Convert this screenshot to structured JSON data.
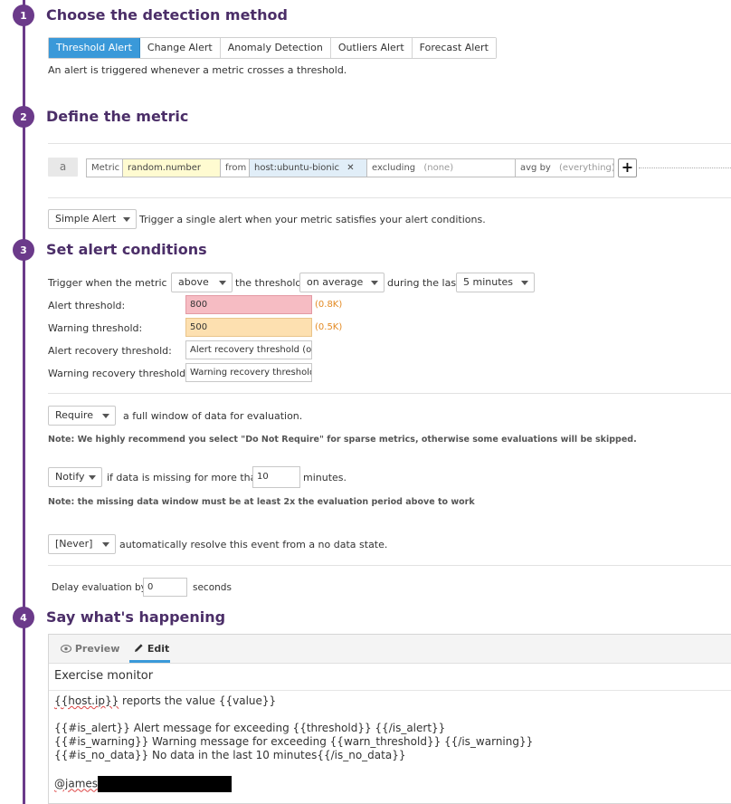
{
  "steps": [
    {
      "number": "1",
      "title": "Choose the detection method"
    },
    {
      "number": "2",
      "title": "Define the metric"
    },
    {
      "number": "3",
      "title": "Set alert conditions"
    },
    {
      "number": "4",
      "title": "Say what's happening"
    }
  ],
  "detection": {
    "tabs": [
      "Threshold Alert",
      "Change Alert",
      "Anomaly Detection",
      "Outliers Alert",
      "Forecast Alert"
    ],
    "active_tab": "Threshold Alert",
    "description": "An alert is triggered whenever a metric crosses a threshold."
  },
  "metric": {
    "query_tag": "a",
    "metric_label": "Metric",
    "metric_value": "random.number",
    "from_label": "from",
    "from_value": "host:ubuntu-bionic",
    "remove_glyph": "✕",
    "excluding_label": "excluding",
    "excluding_placeholder": "(none)",
    "avg_by_label": "avg by",
    "avg_by_placeholder": "(everything)",
    "add_glyph": "+"
  },
  "alert_type": {
    "selected": "Simple Alert",
    "description": "Trigger a single alert when your metric satisfies your alert conditions."
  },
  "conditions": {
    "trigger_prefix": "Trigger when the metric is",
    "comparison": "above",
    "threshold_label": "the threshold",
    "aggregation": "on average",
    "during_label": "during the last",
    "window": "5 minutes",
    "alert_threshold_label": "Alert threshold:",
    "alert_threshold_value": "800",
    "alert_threshold_hint": "(0.8K)",
    "warning_threshold_label": "Warning threshold:",
    "warning_threshold_value": "500",
    "warning_threshold_hint": "(0.5K)",
    "alert_recovery_label": "Alert recovery threshold:",
    "alert_recovery_placeholder": "Alert recovery threshold (opt",
    "warning_recovery_label": "Warning recovery threshold:",
    "warning_recovery_placeholder": "Warning recovery threshold"
  },
  "require": {
    "selected": "Require",
    "text": "a full window of data for evaluation.",
    "note": "Note: We highly recommend you select \"Do Not Require\" for sparse metrics, otherwise some evaluations will be skipped."
  },
  "notify": {
    "selected": "Notify",
    "text": "if data is missing for more than",
    "minutes_value": "10",
    "minutes_label": "minutes.",
    "note": "Note: the missing data window must be at least 2x the evaluation period above to work"
  },
  "resolve": {
    "selected": "[Never]",
    "text": "automatically resolve this event from a no data state."
  },
  "delay": {
    "label": "Delay evaluation by",
    "value": "0",
    "unit": "seconds"
  },
  "message": {
    "tabs": {
      "preview": "Preview",
      "edit": "Edit"
    },
    "title": "Exercise monitor",
    "line1_var": "{{host.ip}}",
    "line1_rest": " reports the value {{value}}",
    "line2": "{{#is_alert}} Alert message for exceeding {{threshold}} {{/is_alert}}",
    "line3": "{{#is_warning}} Warning message for exceeding {{warn_threshold}} {{/is_warning}}",
    "line4": "{{#is_no_data}} No data in the last 10 minutes{{/is_no_data}}",
    "mention": "@james"
  }
}
